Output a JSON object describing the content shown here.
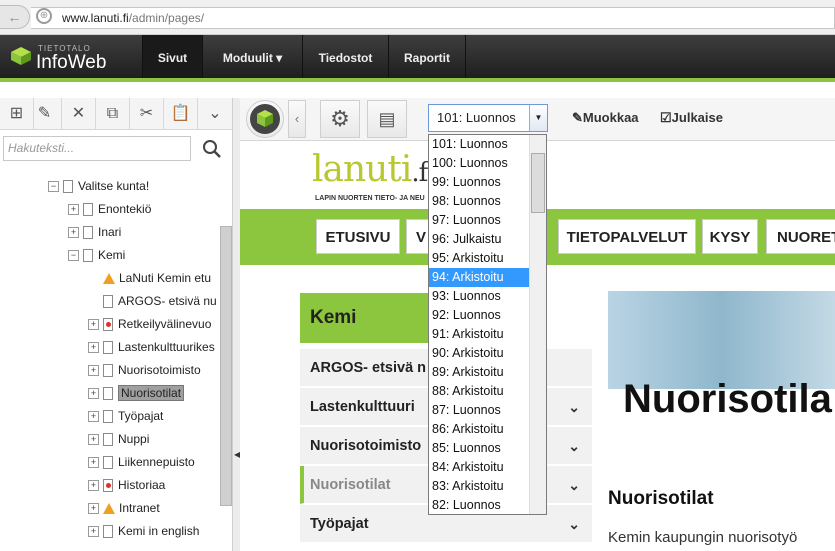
{
  "browser": {
    "url_host": "www.lanuti.fi",
    "url_path": "/admin/pages/"
  },
  "topnav": {
    "logo_small": "TIETOTALO",
    "logo_big": "InfoWeb",
    "items": [
      {
        "label": "Sivut",
        "active": true
      },
      {
        "label": "Moduulit ▾",
        "active": false
      },
      {
        "label": "Tiedostot",
        "active": false
      },
      {
        "label": "Raportit",
        "active": false
      }
    ]
  },
  "sidebar": {
    "search_placeholder": "Hakuteksti...",
    "tree": [
      {
        "label": "Valitse kunta!",
        "icon": "page",
        "expander": "−",
        "level": 2
      },
      {
        "label": "Enontekiö",
        "icon": "page",
        "expander": "+",
        "level": 3
      },
      {
        "label": "Inari",
        "icon": "page",
        "expander": "+",
        "level": 3
      },
      {
        "label": "Kemi",
        "icon": "page",
        "expander": "−",
        "level": 3
      },
      {
        "label": "LaNuti Kemin etu",
        "icon": "warning",
        "expander": "",
        "level": 4
      },
      {
        "label": "ARGOS- etsivä nu",
        "icon": "page",
        "expander": "",
        "level": 4
      },
      {
        "label": "Retkeilyvälinevuo",
        "icon": "page-red",
        "expander": "+",
        "level": 4
      },
      {
        "label": "Lastenkulttuurikes",
        "icon": "page",
        "expander": "+",
        "level": 4
      },
      {
        "label": "Nuorisotoimisto",
        "icon": "page",
        "expander": "+",
        "level": 4
      },
      {
        "label": "Nuorisotilat",
        "icon": "page",
        "expander": "+",
        "level": 4,
        "selected": true
      },
      {
        "label": "Työpajat",
        "icon": "page",
        "expander": "+",
        "level": 4
      },
      {
        "label": "Nuppi",
        "icon": "page",
        "expander": "+",
        "level": 4
      },
      {
        "label": "Liikennepuisto",
        "icon": "page",
        "expander": "+",
        "level": 4
      },
      {
        "label": "Historiaa",
        "icon": "page-red",
        "expander": "+",
        "level": 4
      },
      {
        "label": "Intranet",
        "icon": "warning",
        "expander": "+",
        "level": 4
      },
      {
        "label": "Kemi in english",
        "icon": "page",
        "expander": "+",
        "level": 4
      }
    ]
  },
  "toolbar": {
    "version_selected": "101: Luonnos",
    "edit_label": "Muokkaa",
    "publish_label": "Julkaise"
  },
  "versions": [
    "101: Luonnos",
    "100: Luonnos",
    "99: Luonnos",
    "98: Luonnos",
    "97: Luonnos",
    "96: Julkaistu",
    "95: Arkistoitu",
    "94: Arkistoitu",
    "93: Luonnos",
    "92: Luonnos",
    "91: Arkistoitu",
    "90: Arkistoitu",
    "89: Arkistoitu",
    "88: Arkistoitu",
    "87: Luonnos",
    "86: Arkistoitu",
    "85: Luonnos",
    "84: Arkistoitu",
    "83: Arkistoitu",
    "82: Luonnos"
  ],
  "version_highlighted_index": 7,
  "site": {
    "logo": "lanuti",
    "logo_fi": ".fi",
    "tagline": "LAPIN NUORTEN TIETO- JA NEU",
    "menu": [
      "ETUSIVU",
      "V",
      "TIETOPALVELUT",
      "KYSY",
      "NUORET"
    ],
    "section_title": "Kemi",
    "side_items": [
      {
        "label": "ARGOS- etsivä n",
        "chevron": false,
        "active": false
      },
      {
        "label": "Lastenkulttuuri",
        "chevron": true,
        "active": false
      },
      {
        "label": "Nuorisotoimisto",
        "chevron": true,
        "active": false
      },
      {
        "label": "Nuorisotilat",
        "chevron": true,
        "active": true
      },
      {
        "label": "Työpajat",
        "chevron": true,
        "active": false
      }
    ],
    "page_title": "Nuorisotila",
    "subheading": "Nuorisotilat",
    "body_text": "Kemin kaupungin nuorisotyö"
  }
}
